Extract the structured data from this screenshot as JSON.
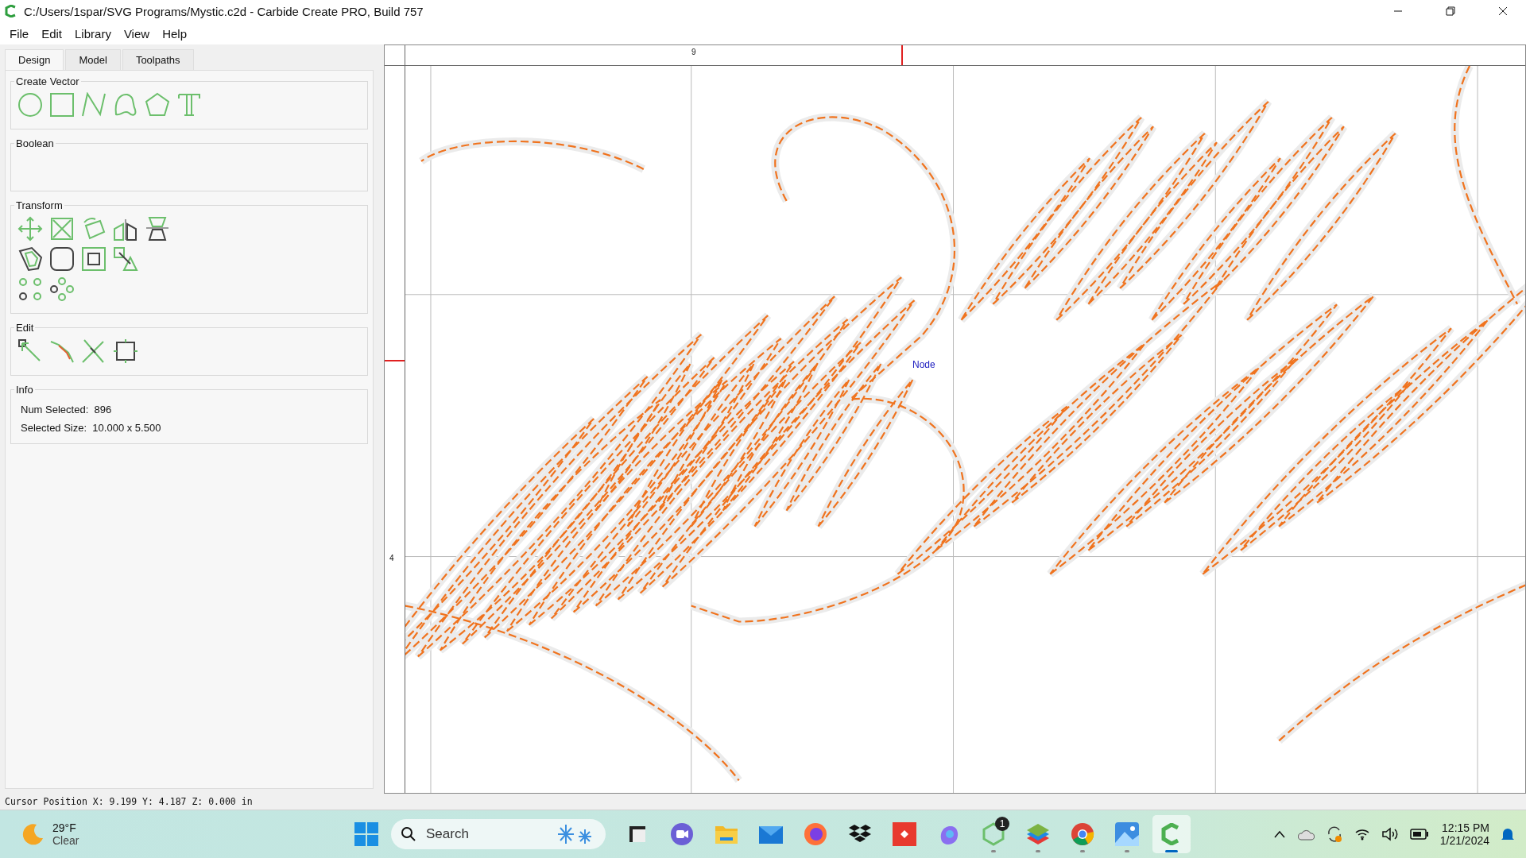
{
  "window": {
    "title": "C:/Users/1spar/SVG Programs/Mystic.c2d - Carbide Create PRO, Build 757"
  },
  "menu": [
    "File",
    "Edit",
    "Library",
    "View",
    "Help"
  ],
  "tabs": [
    {
      "label": "Design",
      "selected": true
    },
    {
      "label": "Model",
      "selected": false
    },
    {
      "label": "Toolpaths",
      "selected": false
    }
  ],
  "groups": [
    {
      "title": "Create Vector",
      "kind": "create"
    },
    {
      "title": "Boolean",
      "kind": "empty"
    },
    {
      "title": "Transform",
      "kind": "transform"
    },
    {
      "title": "Edit",
      "kind": "edit"
    },
    {
      "title": "Info",
      "kind": "info",
      "rows": [
        {
          "label": "Num Selected:",
          "value": "896"
        },
        {
          "label": "Selected Size:",
          "value": "10.000 x 5.500"
        }
      ]
    }
  ],
  "canvas": {
    "top_ruler_label": "9",
    "left_ruler_label": "4",
    "node_label": "Node"
  },
  "status_bar": "Cursor Position X: 9.199 Y: 4.187 Z: 0.000 in",
  "taskbar": {
    "weather": {
      "temperature": "29°F",
      "condition": "Clear"
    },
    "search": {
      "placeholder": "Search"
    },
    "apps": [
      {
        "kind": "files",
        "running": false,
        "selected": false
      },
      {
        "kind": "meet",
        "running": false,
        "selected": false
      },
      {
        "kind": "folder",
        "running": false,
        "selected": false
      },
      {
        "kind": "mail",
        "running": false,
        "selected": false
      },
      {
        "kind": "browser",
        "running": false,
        "selected": false
      },
      {
        "kind": "boxes",
        "running": false,
        "selected": false
      },
      {
        "kind": "diamond",
        "running": false,
        "selected": false
      },
      {
        "kind": "copilot",
        "running": false,
        "selected": false
      },
      {
        "kind": "hex",
        "running": true,
        "selected": false,
        "badge": "1"
      },
      {
        "kind": "stack",
        "running": true,
        "selected": false
      },
      {
        "kind": "chrome",
        "running": true,
        "selected": false
      },
      {
        "kind": "photos",
        "running": true,
        "selected": false
      },
      {
        "kind": "carbide",
        "running": true,
        "selected": true
      }
    ],
    "time": "12:15 PM",
    "date": "1/21/2024"
  }
}
